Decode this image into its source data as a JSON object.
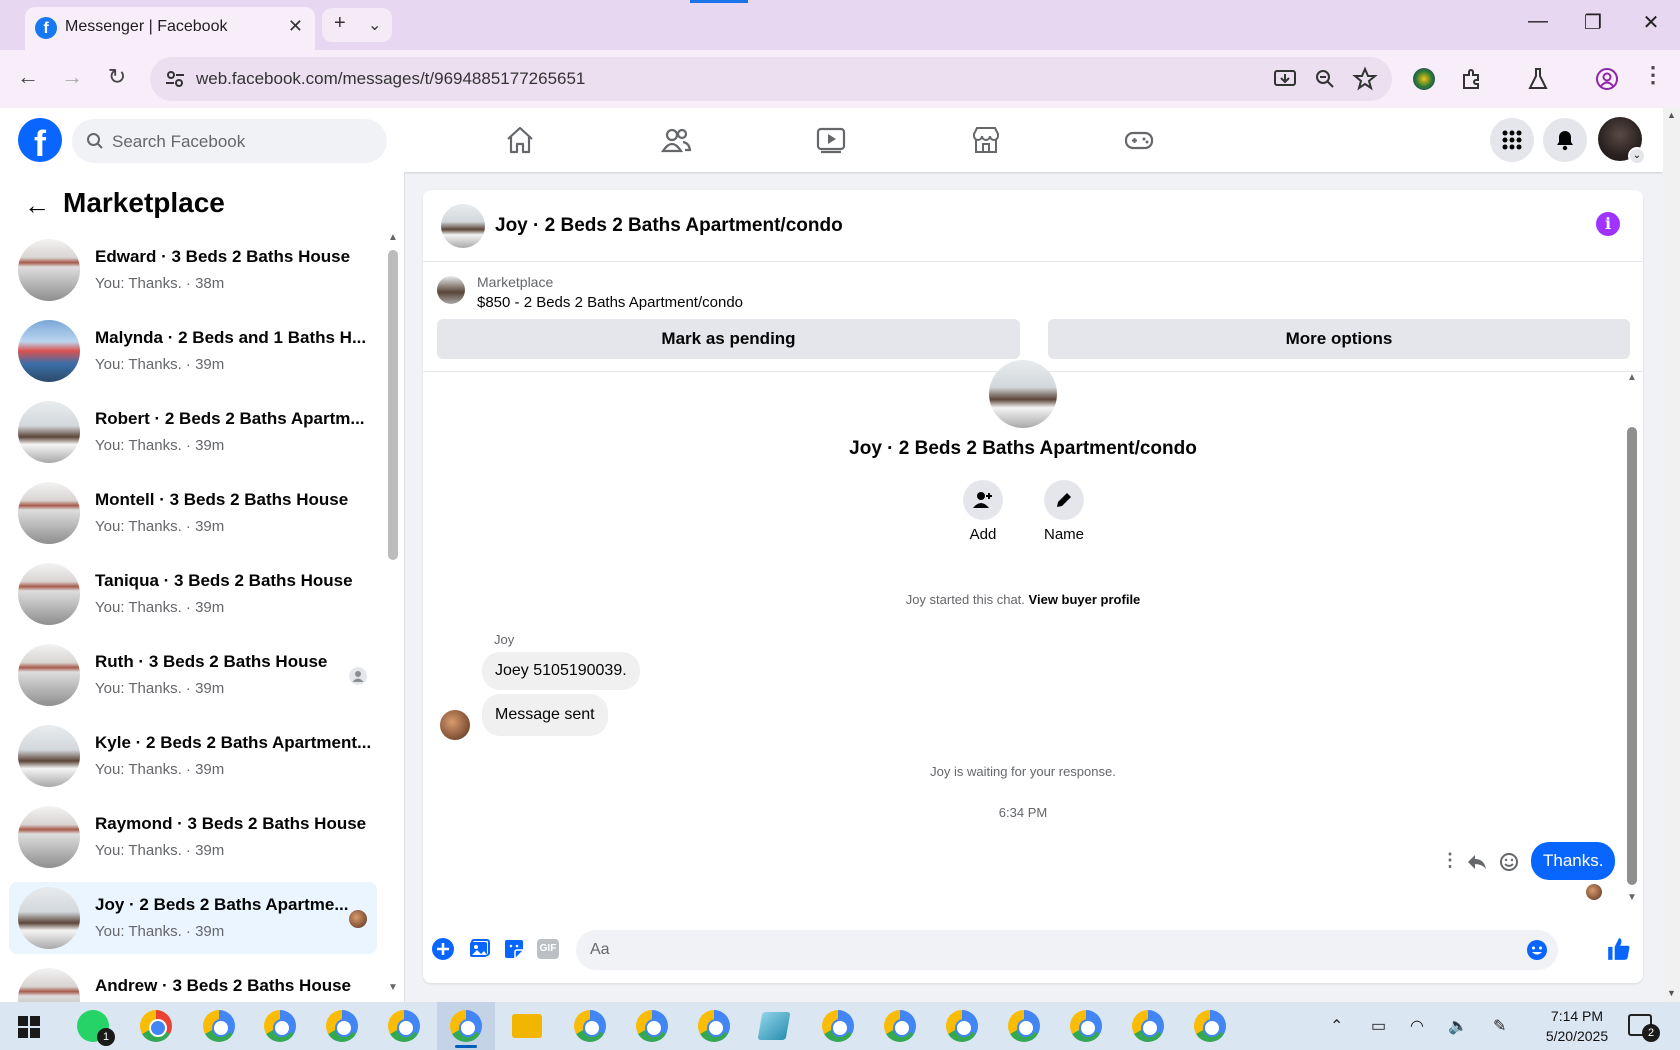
{
  "browser": {
    "tab_title": "Messenger | Facebook",
    "url": "web.facebook.com/messages/t/9694885177265651",
    "new_tab_label": "+",
    "tab_list_label": "⌄"
  },
  "facebook": {
    "search_placeholder": "Search Facebook",
    "nav": [
      "home-icon",
      "friends-icon",
      "video-icon",
      "marketplace-icon",
      "gaming-icon"
    ]
  },
  "sidebar": {
    "title": "Marketplace",
    "conversations": [
      {
        "name": "Edward · 3 Beds 2 Baths House",
        "preview": "You: Thanks. · 38m"
      },
      {
        "name": "Malynda · 2 Beds and 1 Baths H...",
        "preview": "You: Thanks. · 39m"
      },
      {
        "name": "Robert · 2 Beds 2 Baths Apartm...",
        "preview": "You: Thanks. · 39m"
      },
      {
        "name": "Montell · 3 Beds 2 Baths House",
        "preview": "You: Thanks. · 39m"
      },
      {
        "name": "Taniqua · 3 Beds 2 Baths House",
        "preview": "You: Thanks. · 39m"
      },
      {
        "name": "Ruth · 3 Beds 2 Baths House",
        "preview": "You: Thanks. · 39m"
      },
      {
        "name": "Kyle · 2 Beds 2 Baths Apartment...",
        "preview": "You: Thanks. · 39m"
      },
      {
        "name": "Raymond · 3 Beds 2 Baths House",
        "preview": "You: Thanks. · 39m"
      },
      {
        "name": "Joy · 2 Beds 2 Baths Apartme...",
        "preview": "You: Thanks. · 39m"
      },
      {
        "name": "Andrew · 3 Beds 2 Baths House",
        "preview": ""
      }
    ]
  },
  "chat": {
    "title": "Joy · 2 Beds 2 Baths Apartment/condo",
    "listing_source": "Marketplace",
    "listing_price": "$850 - 2 Beds 2 Baths Apartment/condo",
    "mark_pending": "Mark as pending",
    "more_options": "More options",
    "header_name": "Joy · 2 Beds 2 Baths Apartment/condo",
    "add_label": "Add",
    "name_label": "Name",
    "started_text": "Joy started this chat.",
    "view_profile": "View buyer profile",
    "sender": "Joy",
    "message1": "Joey 5105190039.",
    "message2": "Message sent",
    "waiting": "Joy is waiting for your response.",
    "timestamp": "6:34 PM",
    "my_message": "Thanks.",
    "input_placeholder": "Aa"
  },
  "taskbar": {
    "time": "7:14 PM",
    "date": "5/20/2025",
    "whatsapp_badge": "1",
    "notif_badge": "2"
  },
  "colors": {
    "fb_blue": "#0866ff",
    "info_purple": "#a033ff",
    "active_conv": "#ebf5ff"
  }
}
